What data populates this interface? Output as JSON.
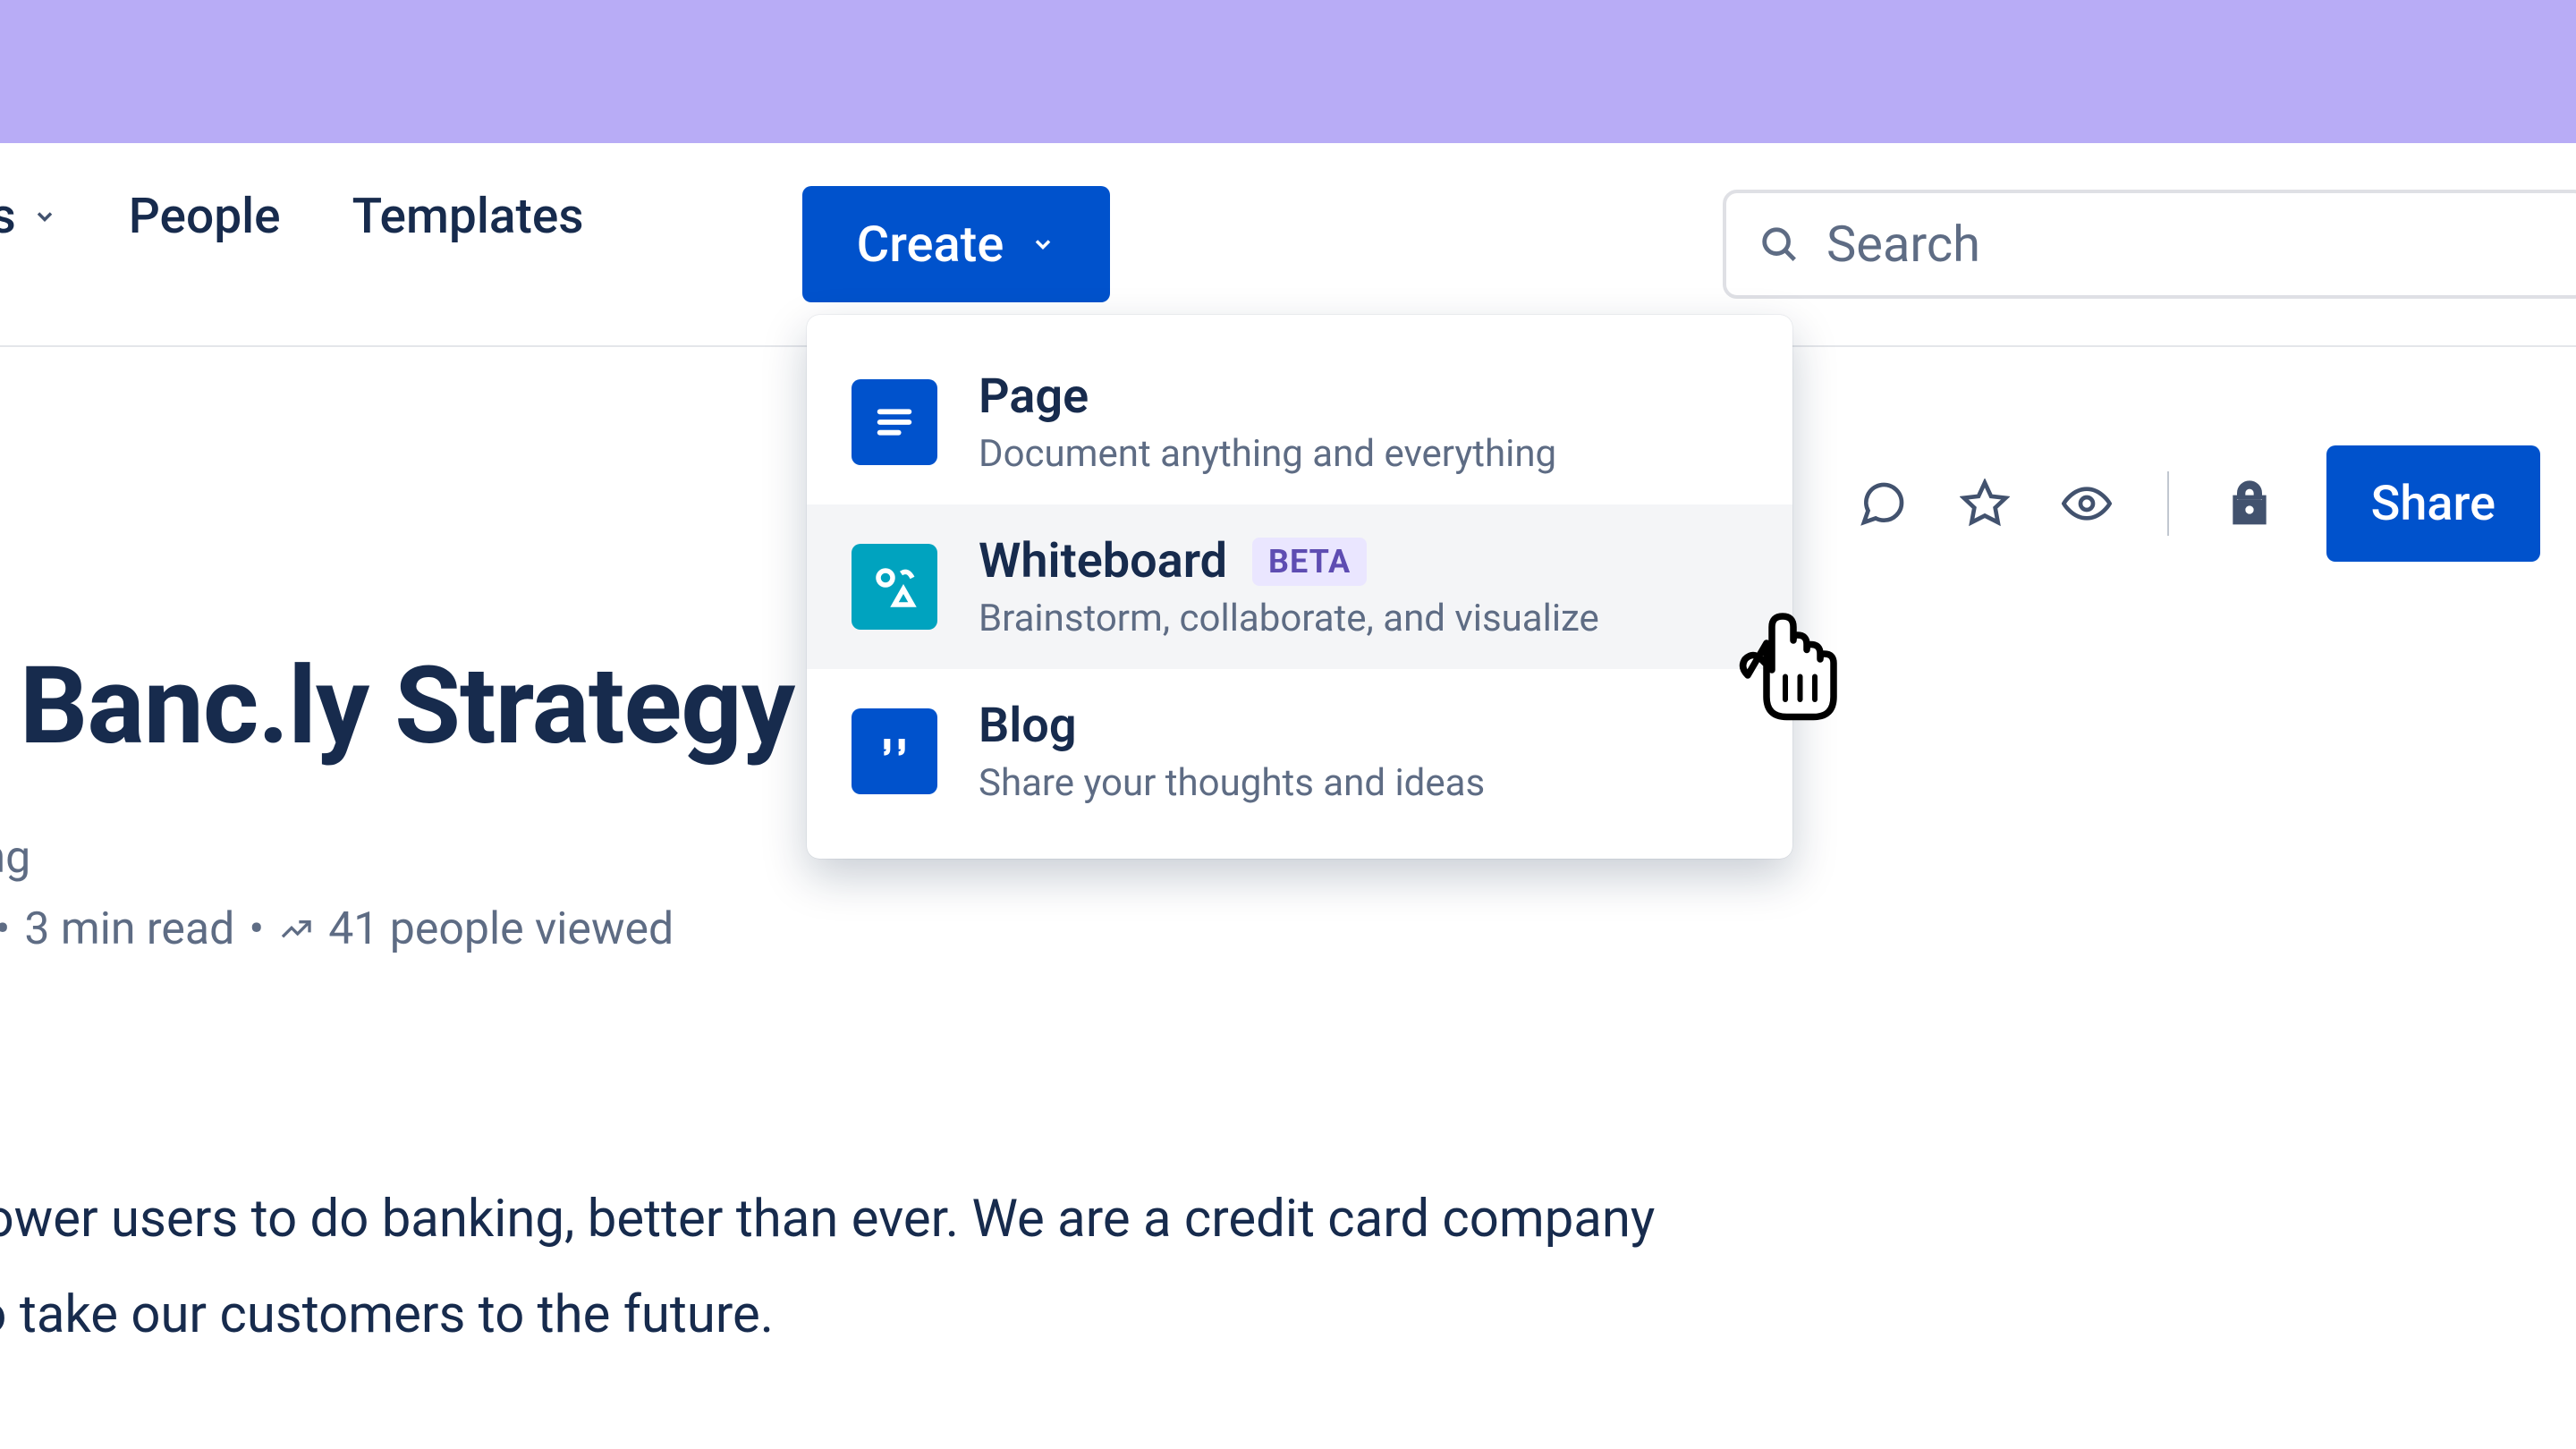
{
  "nav": {
    "frag_suffix": "es",
    "people": "People",
    "templates": "Templates",
    "create": "Create"
  },
  "search": {
    "placeholder": "Search"
  },
  "dropdown": {
    "page": {
      "title": "Page",
      "desc": "Document anything and everything"
    },
    "whiteboard": {
      "title": "Whiteboard",
      "badge": "BETA",
      "desc": "Brainstorm, collaborate, and visualize"
    },
    "blog": {
      "title": "Blog",
      "desc": "Share your thoughts and ideas"
    }
  },
  "actions": {
    "share": "Share"
  },
  "page": {
    "title_fragment": "r Banc.ly Strategy",
    "byline_fragment": "ong",
    "meta_fragment_prefix": "o",
    "read_time": "3 min read",
    "viewed_count": "41 people viewed",
    "body_line1": "power users to do banking, better than ever. We are a credit card company",
    "body_line2": "to take our customers to the future."
  },
  "colors": {
    "primary": "#0052CC",
    "teal": "#00A3BF",
    "purpleBanner": "#B8ACF6"
  }
}
